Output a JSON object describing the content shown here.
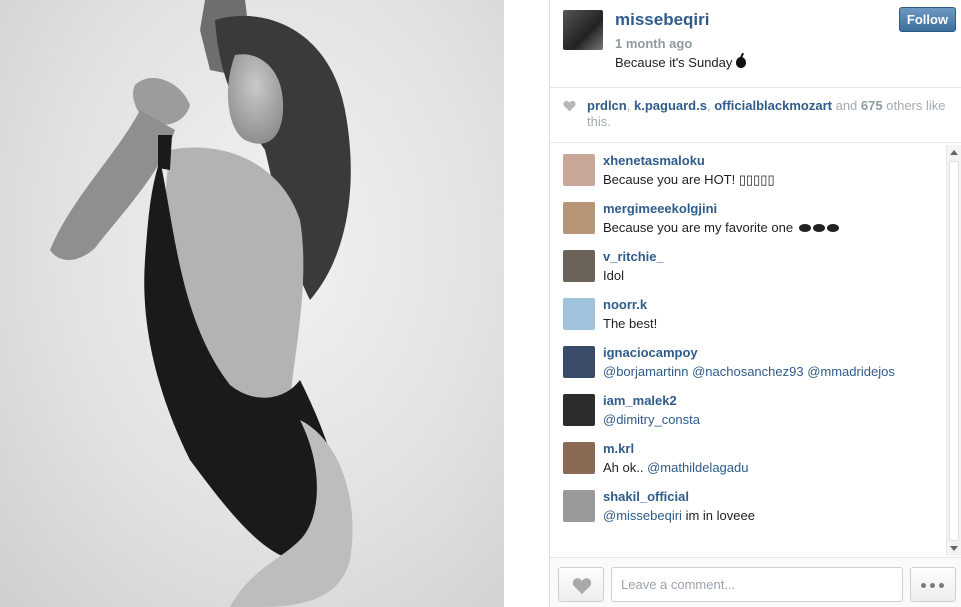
{
  "post": {
    "username": "missebeqiri",
    "time_ago": "1 month ago",
    "caption": "Because it's Sunday",
    "caption_emoji_icon": "apple-icon",
    "follow_label": "Follow"
  },
  "likes": {
    "likers": [
      "prdlcn",
      "k.paguard.s",
      "officialblackmozart"
    ],
    "sep1": ",",
    "sep2": ",",
    "and_text": "and",
    "count": "675",
    "suffix": "others like this."
  },
  "comments": [
    {
      "user": "xhenetasmaloku",
      "text": "Because you are HOT! ▯▯▯▯▯",
      "avatar_color": "#c9a89a"
    },
    {
      "user": "mergimeeekolgjini",
      "text": "Because you are my favorite one",
      "avatar_color": "#b99577"
    },
    {
      "user": "v_ritchie_",
      "text": "Idol",
      "avatar_color": "#6b6259"
    },
    {
      "user": "noorr.k",
      "text": "The best!",
      "avatar_color": "#9fc3dd"
    },
    {
      "user": "ignaciocampoy",
      "mentions": [
        "@borjamartinn",
        "@nachosanchez93",
        "@mmadridejos"
      ],
      "avatar_color": "#3b4b6a"
    },
    {
      "user": "iam_malek2",
      "mentions": [
        "@dimitry_consta"
      ],
      "avatar_color": "#2c2c2c"
    },
    {
      "user": "m.krl",
      "text": "Ah ok..",
      "mentions": [
        "@mathildelagadu"
      ],
      "avatar_color": "#8a6a55"
    },
    {
      "user": "shakil_official",
      "mentions": [
        "@missebeqiri"
      ],
      "text_after": "im in loveee",
      "avatar_color": "#9a9a9a"
    }
  ],
  "footer": {
    "comment_placeholder": "Leave a comment..."
  },
  "colors": {
    "link_blue": "#2f5c8a",
    "follow_button": "#3f6f9f",
    "muted_text": "#8f9aa4"
  }
}
